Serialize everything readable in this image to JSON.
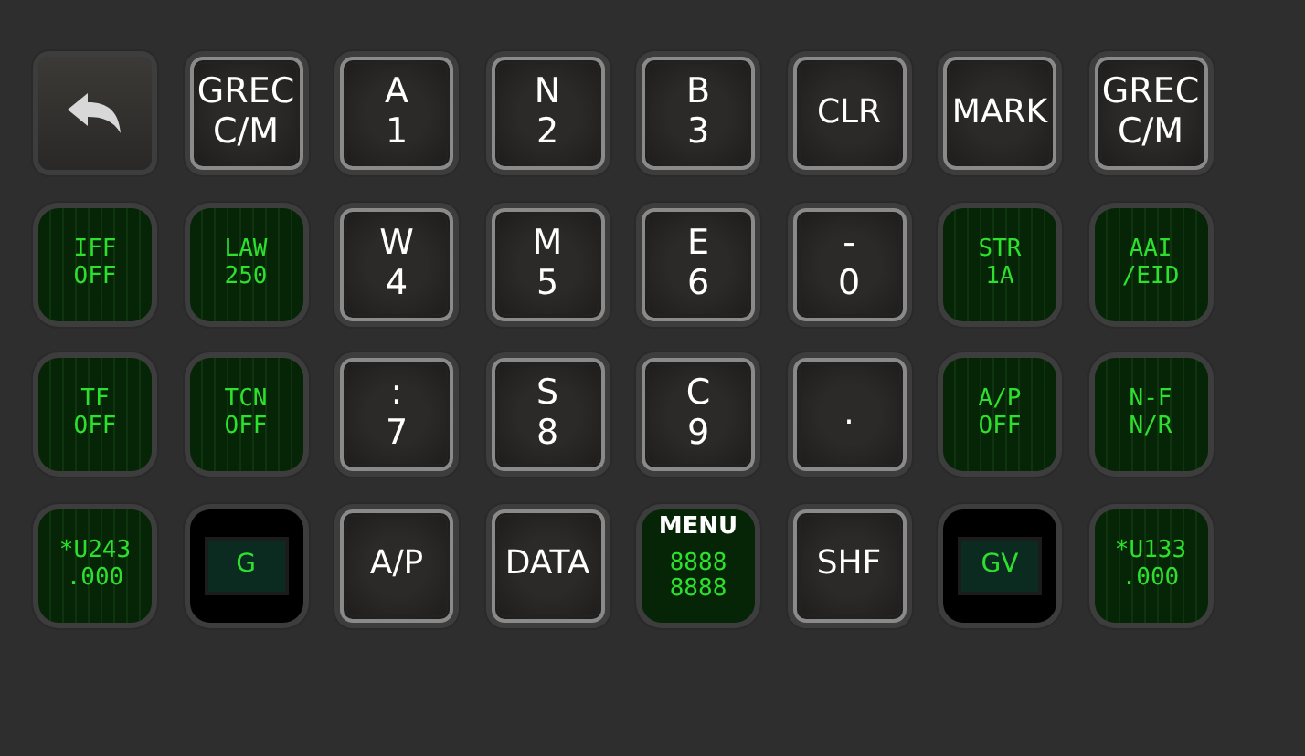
{
  "keys": [
    {
      "kind": "back"
    },
    {
      "kind": "key",
      "lines": [
        "GREC",
        "C/M"
      ]
    },
    {
      "kind": "key",
      "lines": [
        "A",
        "1"
      ]
    },
    {
      "kind": "key",
      "lines": [
        "N",
        "2"
      ]
    },
    {
      "kind": "key",
      "lines": [
        "B",
        "3"
      ]
    },
    {
      "kind": "key",
      "lines": [
        "CLR"
      ]
    },
    {
      "kind": "key",
      "lines": [
        "MARK"
      ]
    },
    {
      "kind": "key",
      "lines": [
        "GREC",
        "C/M"
      ]
    },
    {
      "kind": "display",
      "lines": [
        "IFF",
        "OFF"
      ]
    },
    {
      "kind": "display",
      "lines": [
        "LAW",
        "250"
      ]
    },
    {
      "kind": "key",
      "lines": [
        "W",
        "4"
      ]
    },
    {
      "kind": "key",
      "lines": [
        "M",
        "5"
      ]
    },
    {
      "kind": "key",
      "lines": [
        "E",
        "6"
      ]
    },
    {
      "kind": "key",
      "lines": [
        "-",
        "0"
      ]
    },
    {
      "kind": "display",
      "lines": [
        "STR",
        "1A"
      ]
    },
    {
      "kind": "display",
      "lines": [
        "AAI",
        "/EID"
      ]
    },
    {
      "kind": "display",
      "lines": [
        "TF",
        "OFF"
      ]
    },
    {
      "kind": "display",
      "lines": [
        "TCN",
        "OFF"
      ]
    },
    {
      "kind": "key",
      "lines": [
        ":",
        "7"
      ]
    },
    {
      "kind": "key",
      "lines": [
        "S",
        "8"
      ]
    },
    {
      "kind": "key",
      "lines": [
        "C",
        "9"
      ]
    },
    {
      "kind": "key",
      "lines": [
        "."
      ]
    },
    {
      "kind": "display",
      "lines": [
        "A/P",
        "OFF"
      ]
    },
    {
      "kind": "display",
      "lines": [
        "N-F",
        "N/R"
      ]
    },
    {
      "kind": "display",
      "lines": [
        "*U243",
        ".000"
      ]
    },
    {
      "kind": "window",
      "lines": [
        "G"
      ]
    },
    {
      "kind": "key",
      "lines": [
        "A/P"
      ]
    },
    {
      "kind": "key",
      "lines": [
        "DATA"
      ]
    },
    {
      "kind": "menu",
      "title": "MENU",
      "lines": [
        "8888",
        "8888"
      ]
    },
    {
      "kind": "key",
      "lines": [
        "SHF"
      ]
    },
    {
      "kind": "window",
      "lines": [
        "GV"
      ]
    },
    {
      "kind": "display",
      "lines": [
        "*U133",
        ".000"
      ]
    }
  ]
}
